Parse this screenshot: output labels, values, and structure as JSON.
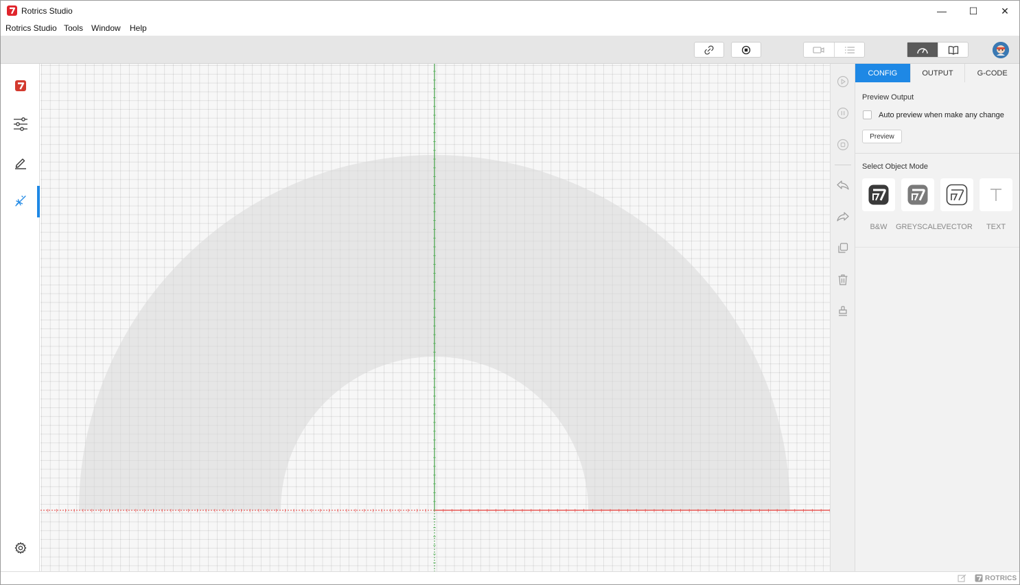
{
  "window": {
    "title": "Rotrics Studio",
    "minimize_glyph": "—",
    "maximize_glyph": "☐",
    "close_glyph": "✕"
  },
  "menu": [
    "Rotrics Studio",
    "Tools",
    "Window",
    "Help"
  ],
  "toolbar": {
    "buttons": [
      "link-icon",
      "stop-icon",
      "camera-icon",
      "list-icon",
      "speedometer-icon",
      "book-icon"
    ],
    "active_mode": "speedometer-icon"
  },
  "sidebar": {
    "items": [
      "rotrics-logo-icon",
      "sliders-icon",
      "pen-icon",
      "laser-icon"
    ],
    "active_item": "laser-icon",
    "bottom_item": "gear-icon"
  },
  "tool_column": [
    "play-icon",
    "pause-icon",
    "stop-circle-icon",
    "undo-icon",
    "redo-icon",
    "duplicate-icon",
    "trash-icon",
    "stamp-icon"
  ],
  "panel": {
    "tabs": [
      "CONFIG",
      "OUTPUT",
      "G-CODE"
    ],
    "active_tab": "CONFIG",
    "preview_output_title": "Preview Output",
    "auto_preview_label": "Auto preview when make any change",
    "auto_preview_checked": false,
    "preview_button": "Preview",
    "select_mode_title": "Select Object Mode",
    "modes": [
      "B&W",
      "GREYSCALE",
      "VECTOR",
      "TEXT"
    ]
  },
  "status": {
    "brand": "ROTRICS"
  },
  "colors": {
    "accent": "#1e88e5",
    "x_axis": "#e53935",
    "y_axis": "#43a047",
    "brand_red": "#e0242b",
    "workspace": "#e6e6e6"
  }
}
